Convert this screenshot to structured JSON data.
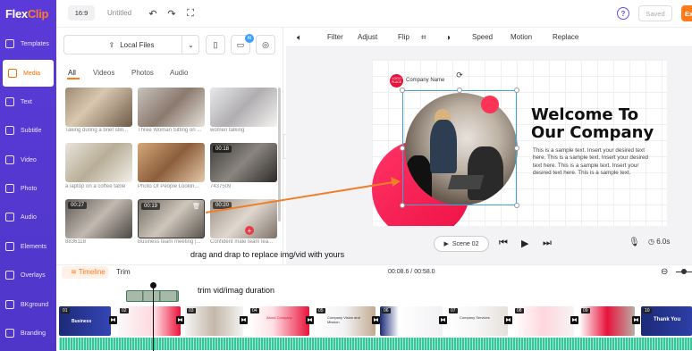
{
  "app": {
    "logo_a": "Flex",
    "logo_b": "Clip"
  },
  "nav": [
    {
      "label": "Templates"
    },
    {
      "label": "Media"
    },
    {
      "label": "Text"
    },
    {
      "label": "Subtitle"
    },
    {
      "label": "Video"
    },
    {
      "label": "Photo"
    },
    {
      "label": "Audio"
    },
    {
      "label": "Elements"
    },
    {
      "label": "Overlays"
    },
    {
      "label": "BKground"
    },
    {
      "label": "Branding"
    }
  ],
  "topbar": {
    "ratio": "16:9",
    "title": "Untitled",
    "undo": "↶",
    "redo": "↷",
    "fullscreen": "⛶",
    "help": "?",
    "saved": "Saved",
    "export": "Ex"
  },
  "panel": {
    "local_files": "Local Files",
    "ai_badge": "AI",
    "filters": [
      "All",
      "Videos",
      "Photos",
      "Audio"
    ],
    "items": [
      {
        "caption": "Taking during a brief stin...",
        "duration": ""
      },
      {
        "caption": "Three Woman Sitting on ...",
        "duration": ""
      },
      {
        "caption": "women talking",
        "duration": ""
      },
      {
        "caption": "a laptop on a coffee table",
        "duration": ""
      },
      {
        "caption": "Photo Of People Lookin...",
        "duration": ""
      },
      {
        "caption": "7437509",
        "duration": "00:18"
      },
      {
        "caption": "8836118",
        "duration": "00:27"
      },
      {
        "caption": "Business team meeting |...",
        "duration": "00:19"
      },
      {
        "caption": "Confident male team lea...",
        "duration": "00:20"
      }
    ]
  },
  "toolbar": {
    "items": [
      "Filter",
      "Adjust",
      "Flip",
      "Speed",
      "Motion",
      "Replace"
    ]
  },
  "slide": {
    "company_name": "Company Name",
    "logo_badge": "LOGO PLACE",
    "headline_1": "Welcome To",
    "headline_2": "Our Company",
    "body": "This is a sample text. Insert your desired text here. This is a sample text. Insert your desired text here. This is a sample text. Insert your desired text here. This is a sample text."
  },
  "player": {
    "scene": "Scene 02",
    "duration": "6.0s"
  },
  "timeline": {
    "tab_timeline": "Timeline",
    "tab_trim": "Trim",
    "time": "00:08.6 / 00:58.0",
    "scenes": [
      {
        "num": "01",
        "title": "Business"
      },
      {
        "num": "02",
        "title": ""
      },
      {
        "num": "03",
        "title": ""
      },
      {
        "num": "04",
        "title": "About Company"
      },
      {
        "num": "05",
        "title": "Company Vision and Mission"
      },
      {
        "num": "06",
        "title": ""
      },
      {
        "num": "07",
        "title": "Company Services"
      },
      {
        "num": "08",
        "title": ""
      },
      {
        "num": "09",
        "title": ""
      },
      {
        "num": "10",
        "title": "Thank You"
      }
    ]
  },
  "annotations": {
    "drag": "drag and drap to replace img/vid with yours",
    "trim": "trim vid/imag duration"
  }
}
